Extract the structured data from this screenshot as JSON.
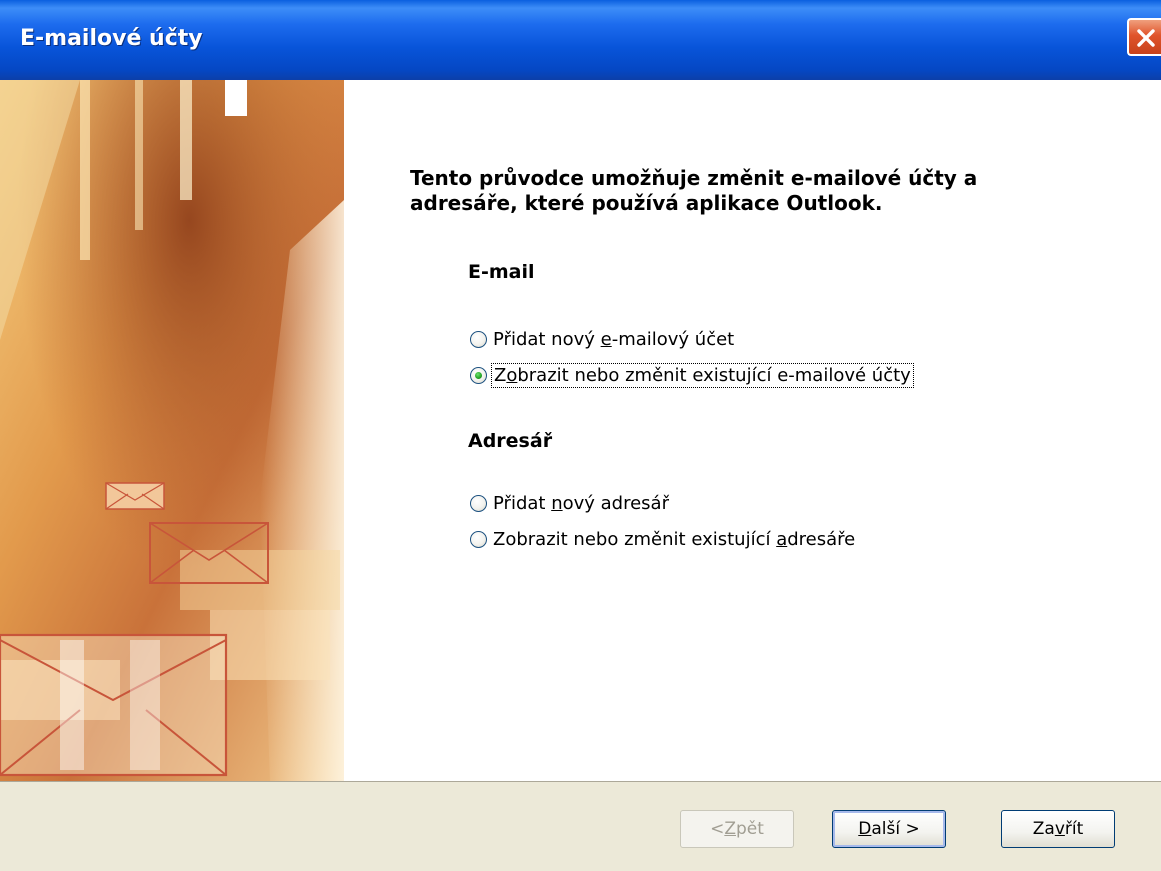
{
  "window": {
    "title": "E-mailové účty"
  },
  "intro": "Tento průvodce umožňuje změnit e-mailové účty a adresáře, které používá aplikace Outlook.",
  "email_section": {
    "title": "E-mail",
    "options": [
      {
        "pre": "Přidat nový ",
        "key": "e",
        "post": "-mailový účet",
        "checked": false
      },
      {
        "pre": "Z",
        "key": "o",
        "post": "brazit nebo změnit existující e-mailové účty",
        "checked": true
      }
    ]
  },
  "address_section": {
    "title": "Adresář",
    "options": [
      {
        "pre": "Přidat ",
        "key": "n",
        "post": "ový adresář",
        "checked": false
      },
      {
        "pre": "Zobrazit nebo změnit existující ",
        "key": "a",
        "post": "dresáře",
        "checked": false
      }
    ]
  },
  "buttons": {
    "back": {
      "pre": "< ",
      "key": "Z",
      "post": "pět",
      "enabled": false
    },
    "next": {
      "pre": "",
      "key": "D",
      "post": "alší >",
      "enabled": true
    },
    "close": {
      "pre": "Za",
      "key": "v",
      "post": "řít",
      "enabled": true
    }
  },
  "colors": {
    "titlebar": "#0A58DD",
    "dialog_bg": "#ECE9D8",
    "radio_selected": "#22A322",
    "close_button": "#E0542B"
  },
  "icons": {
    "close": "close-x-icon",
    "art": "envelope-icon"
  }
}
